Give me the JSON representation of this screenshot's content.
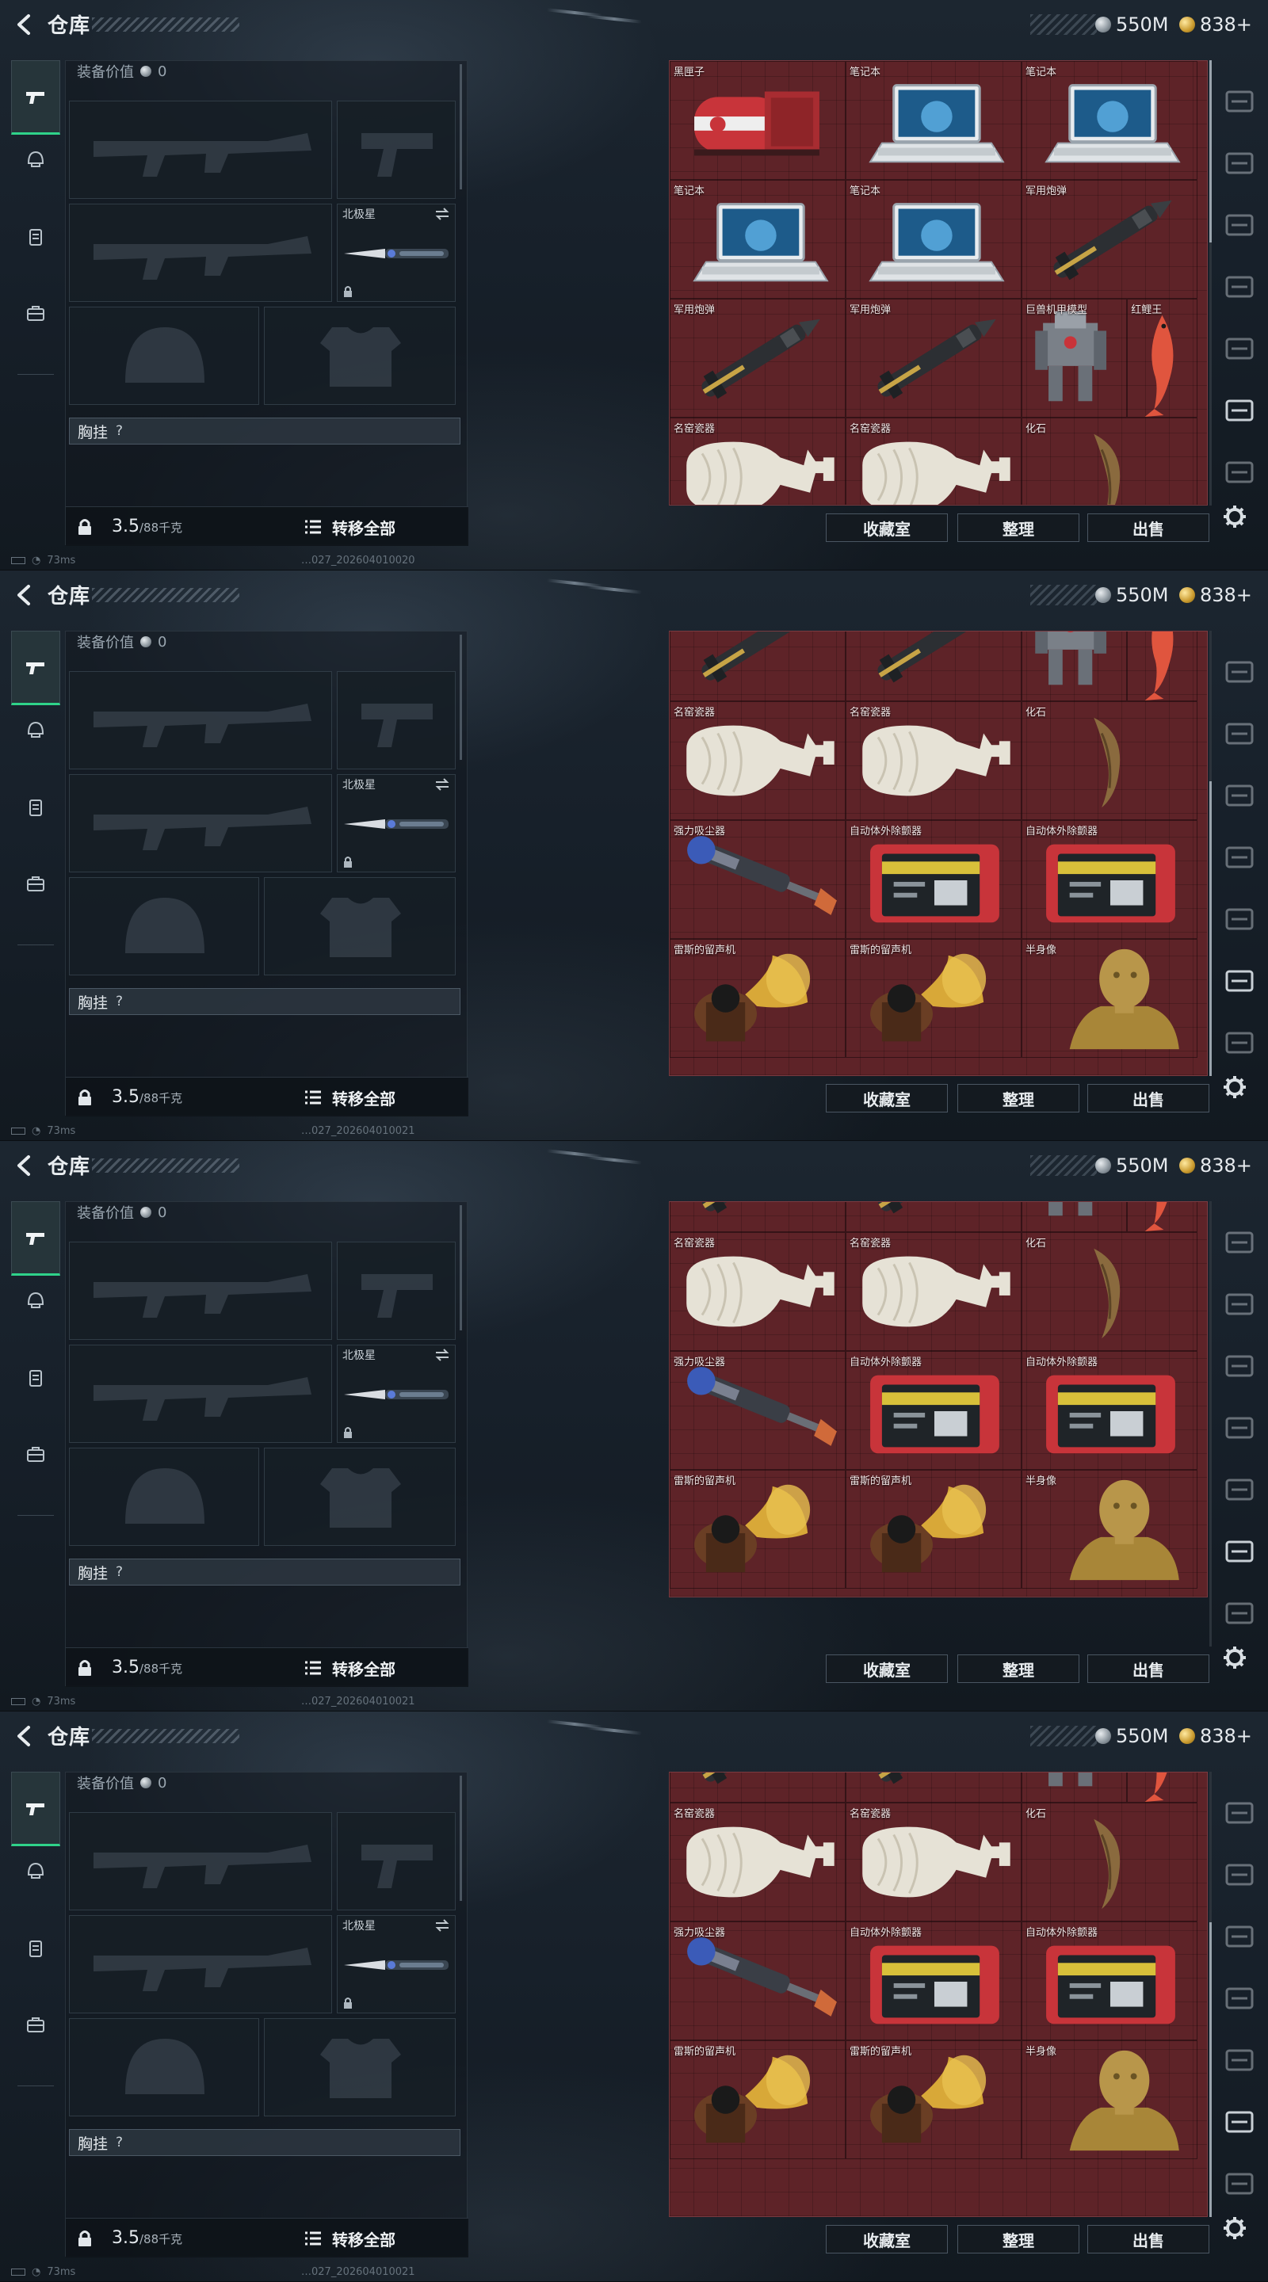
{
  "top": {
    "title": "仓库",
    "silver_amount": "550M",
    "gold_amount": "838+"
  },
  "equip": {
    "value_label": "装备价值",
    "value_amount": "0",
    "melee_name": "北极星",
    "chest_label": "胸挂",
    "chest_hint": "?",
    "weight": "3.5",
    "weight_max": "/88千克",
    "transfer_label": "转移全部"
  },
  "status": {
    "ping": "73ms",
    "codes": [
      "…027_202604010020",
      "…027_202604010021",
      "…027_202604010021",
      "…027_202604010021"
    ]
  },
  "actions": {
    "collection": "收藏室",
    "sort": "整理",
    "sell": "出售"
  },
  "items": {
    "black_box": "黑匣子",
    "laptop": "笔记本",
    "shell": "军用炮弹",
    "mech": "巨兽机甲模型",
    "koi": "红鲤王",
    "vase": "名窑瓷器",
    "fossil": "化石",
    "vacuum": "强力吸尘器",
    "aed": "自动体外除颤器",
    "gramophone": "雷斯的留声机",
    "bust": "半身像"
  },
  "colors": {
    "accent_green": "#2fd38a",
    "inventory_bg": "#5e2328"
  },
  "icons": [
    "back-arrow-icon",
    "silver-coin-icon",
    "gold-coin-icon",
    "pistol-icon",
    "helmet-icon",
    "vest-icon",
    "briefcase-icon",
    "lock-icon",
    "list-icon",
    "gear-icon",
    "swap-icon"
  ]
}
